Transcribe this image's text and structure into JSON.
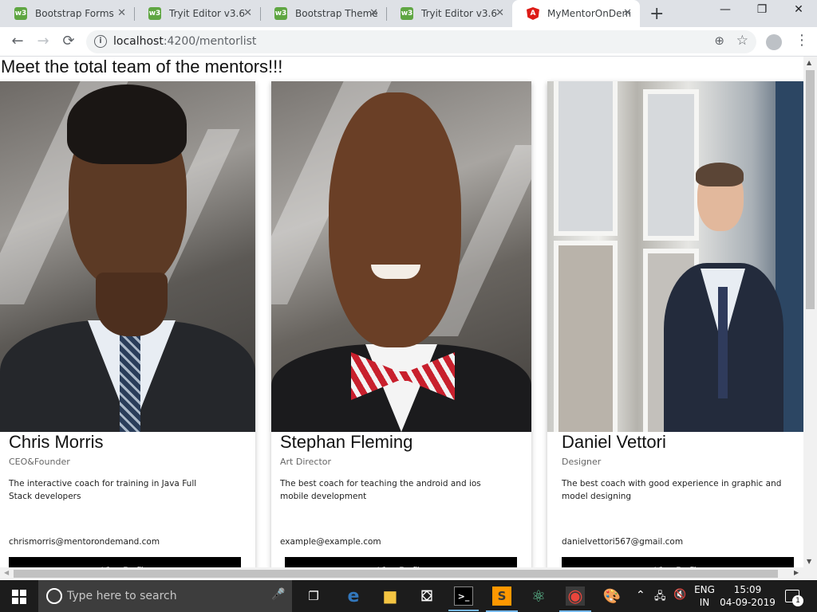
{
  "browser": {
    "tabs": [
      {
        "label": "Bootstrap Forms",
        "favicon": "w3schools-icon",
        "active": false
      },
      {
        "label": "Tryit Editor v3.6",
        "favicon": "w3schools-icon",
        "active": false
      },
      {
        "label": "Bootstrap Theme",
        "favicon": "w3schools-icon",
        "active": false
      },
      {
        "label": "Tryit Editor v3.6",
        "favicon": "w3schools-icon",
        "active": false
      },
      {
        "label": "MyMentorOnDem",
        "favicon": "angular-icon",
        "active": true
      }
    ],
    "favicon_text": {
      "w3": "w3",
      "angular": "A"
    },
    "tab_close_glyph": "✕",
    "new_tab_glyph": "+",
    "window_controls": {
      "minimize": "—",
      "maximize": "❐",
      "close": "✕"
    },
    "url_host": "localhost",
    "url_path": ":4200/mentorlist",
    "nav": {
      "back": "←",
      "forward": "→",
      "reload": "⟳"
    },
    "info_glyph": "i",
    "zoom_glyph": "⊕",
    "bookmark_glyph": "☆",
    "menu_glyph": "⋮"
  },
  "page": {
    "heading": "Meet the total team of the mentors!!!",
    "mentors": [
      {
        "name": "Chris Morris",
        "role": "CEO&Founder",
        "description": "The interactive coach for training in Java Full Stack developers",
        "email": "chrismorris@mentorondemand.com",
        "button": "View Profile"
      },
      {
        "name": "Stephan Fleming",
        "role": "Art Director",
        "description": "The best coach for teaching the android and ios mobile development",
        "email": "example@example.com",
        "button": "View Profile"
      },
      {
        "name": "Daniel Vettori",
        "role": "Designer",
        "description": "The best coach with good experience in graphic and model designing",
        "email": "danielvettori567@gmail.com",
        "button": "View Profile"
      }
    ]
  },
  "scrollbars": {
    "up": "▲",
    "down": "▼",
    "left": "◀",
    "right": "▶"
  },
  "taskbar": {
    "search_placeholder": "Type here to search",
    "mic_glyph": "🎤",
    "language_line1": "ENG",
    "language_line2": "IN",
    "time": "15:09",
    "date": "04-09-2019",
    "notification_count": "1",
    "tray_glyphs": {
      "chevron": "⌃",
      "network": "🖧",
      "volume": "🔇"
    },
    "apps": [
      {
        "icon": "task-view-icon",
        "glyph": "❐"
      },
      {
        "icon": "edge-icon",
        "glyph": "e",
        "color": "#3277bc"
      },
      {
        "icon": "file-explorer-icon",
        "glyph": "■",
        "color": "#f4c542"
      },
      {
        "icon": "store-icon",
        "glyph": "⛋"
      },
      {
        "icon": "command-prompt-icon",
        "glyph": ">_"
      },
      {
        "icon": "sublime-text-icon",
        "glyph": "S",
        "color": "#ff9800"
      },
      {
        "icon": "atom-icon",
        "glyph": "⚛",
        "color": "#66d19e"
      },
      {
        "icon": "chrome-icon",
        "glyph": "◉",
        "color": "#e8453c"
      },
      {
        "icon": "paint-icon",
        "glyph": "🎨"
      }
    ]
  },
  "colors": {
    "button_bg": "#000000",
    "button_text": "#ffffff",
    "tab_strip": "#dee1e6",
    "taskbar": "#1c1c1c"
  }
}
